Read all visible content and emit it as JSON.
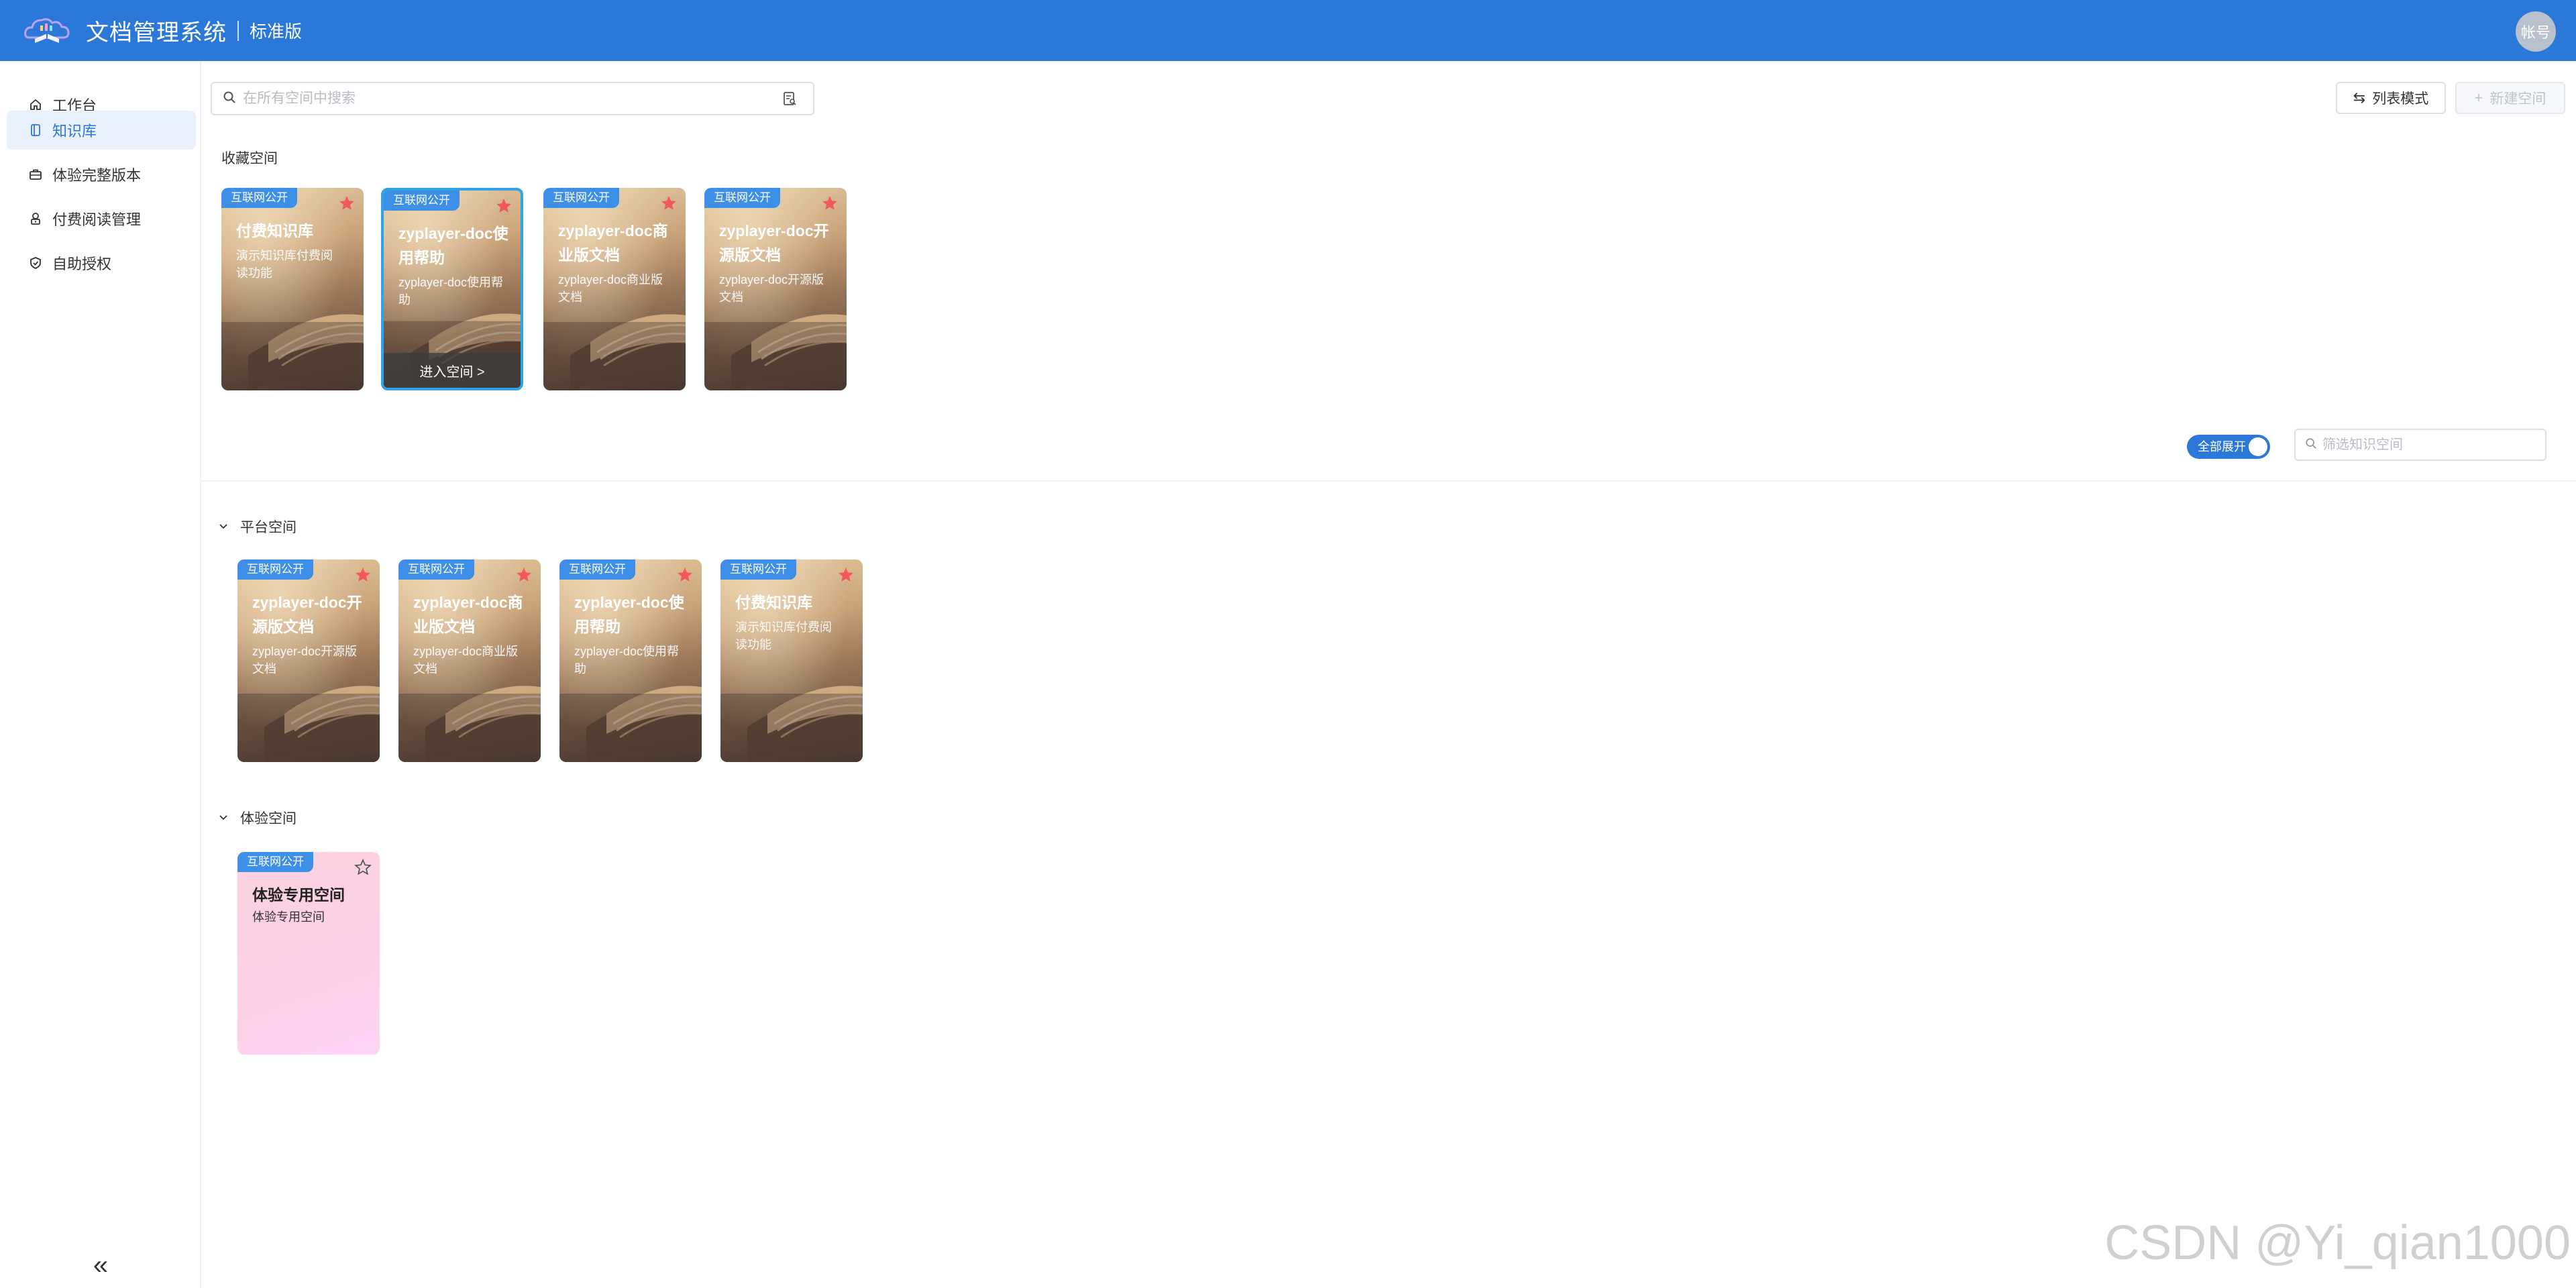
{
  "header": {
    "app_title": "文档管理系统",
    "edition": "标准版",
    "account": "帐号",
    "brand_color": "#2b78d8"
  },
  "sidebar": {
    "items": [
      {
        "label": "工作台",
        "icon": "home-icon",
        "active": false
      },
      {
        "label": "知识库",
        "icon": "book-icon",
        "active": true
      },
      {
        "label": "体验完整版本",
        "icon": "briefcase-icon",
        "active": false
      },
      {
        "label": "付费阅读管理",
        "icon": "user-lock-icon",
        "active": false
      },
      {
        "label": "自助授权",
        "icon": "shield-check-icon",
        "active": false
      }
    ],
    "collapse": "«"
  },
  "toolbar": {
    "search_placeholder": "在所有空间中搜索",
    "list_mode": "列表模式",
    "new_space": "新建空间"
  },
  "favorites": {
    "title": "收藏空间",
    "cards": [
      {
        "badge": "互联网公开",
        "title": "付费知识库",
        "desc": "演示知识库付费阅读功能",
        "starred": true
      },
      {
        "badge": "互联网公开",
        "title": "zyplayer-doc使用帮助",
        "desc": "zyplayer-doc使用帮助",
        "starred": true,
        "enter": "进入空间 >"
      },
      {
        "badge": "互联网公开",
        "title": "zyplayer-doc商业版文档",
        "desc": "zyplayer-doc商业版文档",
        "starred": true
      },
      {
        "badge": "互联网公开",
        "title": "zyplayer-doc开源版文档",
        "desc": "zyplayer-doc开源版文档",
        "starred": true
      }
    ]
  },
  "filter": {
    "toggle_label": "全部展开",
    "toggle_on": true,
    "placeholder": "筛选知识空间"
  },
  "groups": [
    {
      "title": "平台空间",
      "cards": [
        {
          "badge": "互联网公开",
          "title": "zyplayer-doc开源版文档",
          "desc": "zyplayer-doc开源版文档",
          "starred": true
        },
        {
          "badge": "互联网公开",
          "title": "zyplayer-doc商业版文档",
          "desc": "zyplayer-doc商业版文档",
          "starred": true
        },
        {
          "badge": "互联网公开",
          "title": "zyplayer-doc使用帮助",
          "desc": "zyplayer-doc使用帮助",
          "starred": true
        },
        {
          "badge": "互联网公开",
          "title": "付费知识库",
          "desc": "演示知识库付费阅读功能",
          "starred": true
        }
      ]
    },
    {
      "title": "体验空间",
      "cards": [
        {
          "badge": "互联网公开",
          "title": "体验专用空间",
          "desc": "体验专用空间",
          "starred": false
        }
      ]
    }
  ],
  "watermark": "CSDN @Yi_qian1000",
  "colors": {
    "star_filled": "#f05a5a",
    "badge": "#3d8fe8",
    "selected_border": "#2fa3e8"
  }
}
